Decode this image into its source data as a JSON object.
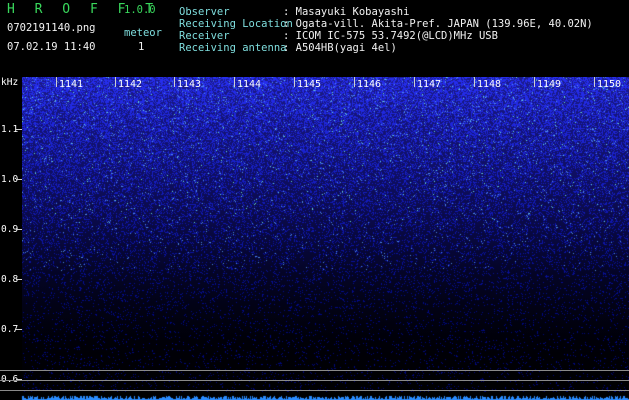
{
  "app": {
    "title": "H R O F F T",
    "version": "1.0.0"
  },
  "file": {
    "name": "0702191140.png",
    "datetime": "07.02.19 11:40"
  },
  "meteor": {
    "label": "meteor",
    "count": "1"
  },
  "info": [
    {
      "label": "Observer",
      "value": ": Masayuki Kobayashi"
    },
    {
      "label": "Receiving Location",
      "value": ": Ogata-vill. Akita-Pref. JAPAN (139.96E, 40.02N)"
    },
    {
      "label": "Receiver",
      "value": ": ICOM IC-575 53.7492(@LCD)MHz USB"
    },
    {
      "label": "Receiving antenna",
      "value": ": A504HB(yagi 4el)"
    }
  ],
  "axis": {
    "unit": "kHz",
    "y_ticks": [
      "1.1",
      "1.0",
      "0.9",
      "0.8",
      "0.7",
      "0.6"
    ],
    "minute_ticks": [
      "1141",
      "1142",
      "1143",
      "1144",
      "1145",
      "1146",
      "1147",
      "1148",
      "1149",
      "1150"
    ]
  },
  "colors": {
    "title": "#39d85c",
    "labels": "#7fdede",
    "values": "#f2f2f2",
    "noise": "#2a2aff"
  }
}
